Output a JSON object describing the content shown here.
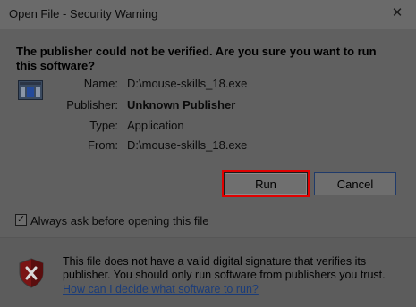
{
  "window": {
    "title": "Open File - Security Warning",
    "close_glyph": "✕"
  },
  "heading": "The publisher could not be verified.  Are you sure you want to run this software?",
  "details": {
    "name_label": "Name:",
    "name_value": "D:\\mouse-skills_18.exe",
    "publisher_label": "Publisher:",
    "publisher_value": "Unknown Publisher",
    "type_label": "Type:",
    "type_value": "Application",
    "from_label": "From:",
    "from_value": "D:\\mouse-skills_18.exe"
  },
  "buttons": {
    "run_label": "Run",
    "cancel_label": "Cancel"
  },
  "checkbox": {
    "label": "Always ask before opening this file",
    "checked_glyph": "✓"
  },
  "footer": {
    "warning_text": "This file does not have a valid digital signature that verifies its publisher.  You should only run software from publishers you trust.",
    "help_link": "How can I decide what software to run?"
  },
  "icons": {
    "app": "application-icon",
    "shield": "security-shield-icon",
    "close": "close-icon"
  },
  "colors": {
    "dim_overlay": "#606060",
    "run_highlight": "#e00000",
    "link": "#1a3c7a"
  }
}
